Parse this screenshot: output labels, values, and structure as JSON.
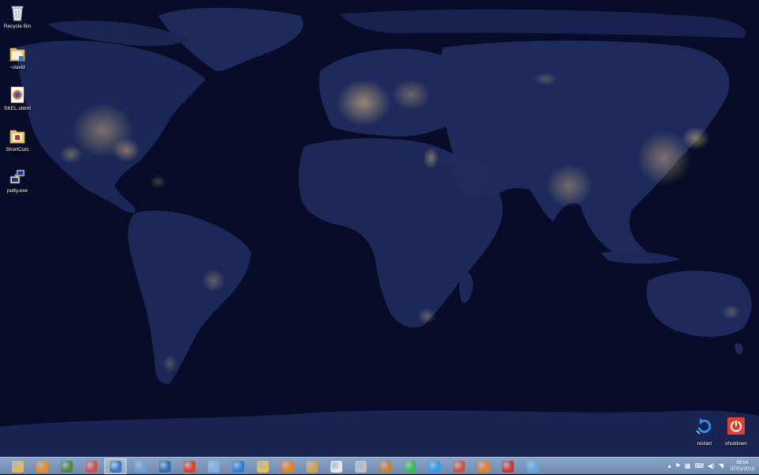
{
  "desktop": {
    "icons": [
      {
        "label": "Recycle Bin",
        "icon": "recycle-bin-icon"
      },
      {
        "label": "~david",
        "icon": "folder-icon"
      },
      {
        "label": "SKEL.shtml",
        "icon": "firefox-document-icon"
      },
      {
        "label": "ShortCuts",
        "icon": "folder-icon"
      },
      {
        "label": "putty.exe",
        "icon": "putty-icon"
      }
    ],
    "corner_icons": [
      {
        "label": "restart",
        "icon": "restart-icon"
      },
      {
        "label": "shutdown",
        "icon": "power-icon"
      }
    ]
  },
  "taskbar": {
    "pinned": [
      {
        "name": "file-explorer",
        "color": "#e8b945"
      },
      {
        "name": "app-orange-circle",
        "color": "#f08a1c"
      },
      {
        "name": "network-manager",
        "color": "#4c8a3c"
      },
      {
        "name": "app-red-swirl",
        "color": "#d94b4b"
      },
      {
        "name": "remote-desktop",
        "color": "#3a78c8"
      },
      {
        "name": "app-shield",
        "color": "#6aa0d8"
      },
      {
        "name": "app-window",
        "color": "#2e6fb8"
      },
      {
        "name": "app-red-fan",
        "color": "#e04020"
      },
      {
        "name": "app-globe",
        "color": "#7ab0e8"
      },
      {
        "name": "app-blue-circle",
        "color": "#2a7fd8"
      },
      {
        "name": "app-arrow",
        "color": "#e8c040"
      },
      {
        "name": "vlc",
        "color": "#f08010"
      },
      {
        "name": "app-pencil",
        "color": "#d8a030"
      },
      {
        "name": "app-fox",
        "color": "#e8e8e8"
      },
      {
        "name": "app-grid",
        "color": "#c0c0c0"
      },
      {
        "name": "app-disc",
        "color": "#c88030"
      },
      {
        "name": "app-green-grid",
        "color": "#30c050"
      },
      {
        "name": "internet-explorer",
        "color": "#2a9fe8"
      },
      {
        "name": "chrome",
        "color": "#e04a3a"
      },
      {
        "name": "firefox",
        "color": "#f07a20"
      },
      {
        "name": "app-ccleaner",
        "color": "#d83030"
      },
      {
        "name": "app-disc-blue",
        "color": "#60a8e0"
      }
    ],
    "active_index": 4,
    "tray": {
      "icons": [
        "chevron-up-icon",
        "flag-icon",
        "network-icon",
        "keyboard-icon",
        "volume-icon",
        "wifi-icon"
      ],
      "time": "09:04",
      "date": "07/01/2013"
    }
  }
}
